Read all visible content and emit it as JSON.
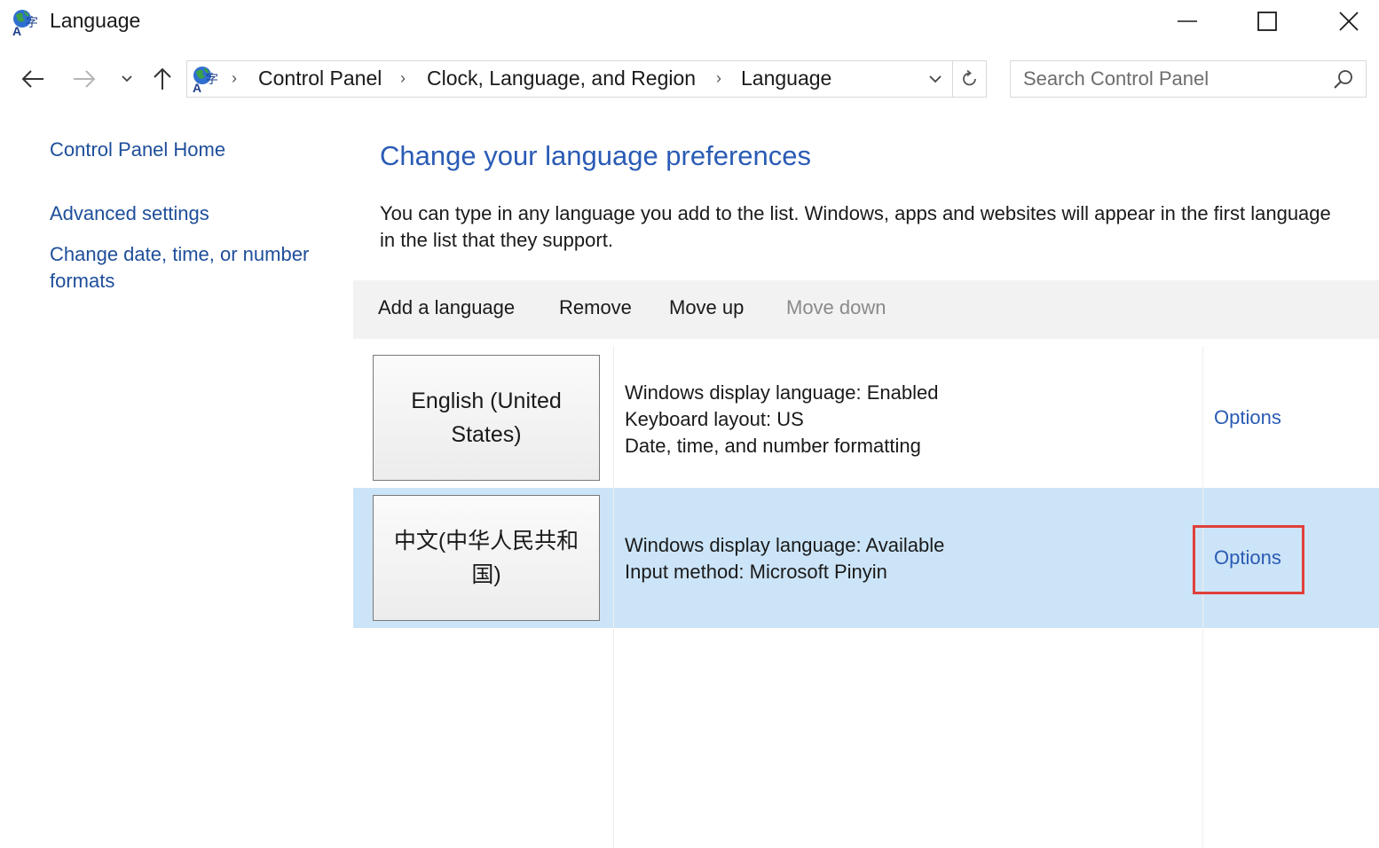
{
  "window": {
    "title": "Language",
    "controls": {
      "minimize_icon": "minimize-icon",
      "maximize_icon": "maximize-icon",
      "close_icon": "close-icon"
    }
  },
  "nav": {
    "back_icon": "arrow-left-icon",
    "forward_icon": "arrow-right-icon",
    "recent_icon": "chevron-down-icon",
    "up_icon": "arrow-up-icon",
    "breadcrumbs": [
      "Control Panel",
      "Clock, Language, and Region",
      "Language"
    ],
    "refresh_icon": "refresh-icon",
    "search": {
      "placeholder": "Search Control Panel",
      "value": ""
    }
  },
  "sidebar": {
    "links": [
      "Control Panel Home",
      "Advanced settings",
      "Change date, time, or number formats"
    ]
  },
  "main": {
    "title": "Change your language preferences",
    "description": "You can type in any language you add to the list. Windows, apps and websites will appear in the first language in the list that they support.",
    "toolbar": {
      "add": "Add a language",
      "remove": "Remove",
      "move_up": "Move up",
      "move_down": "Move down",
      "move_down_disabled": true
    },
    "languages": [
      {
        "name": "English (United States)",
        "details": [
          "Windows display language: Enabled",
          "Keyboard layout: US",
          "Date, time, and number formatting"
        ],
        "options": "Options",
        "selected": false
      },
      {
        "name": "中文(中华人民共和国)",
        "details": [
          "Windows display language: Available",
          "Input method: Microsoft Pinyin"
        ],
        "options": "Options",
        "selected": true
      }
    ]
  },
  "colors": {
    "link": "#1e4e9a",
    "title": "#2a5bb5",
    "selected_row": "#cce4f7",
    "toolbar_bg": "#f2f2f2",
    "highlight": "#e0403a"
  }
}
